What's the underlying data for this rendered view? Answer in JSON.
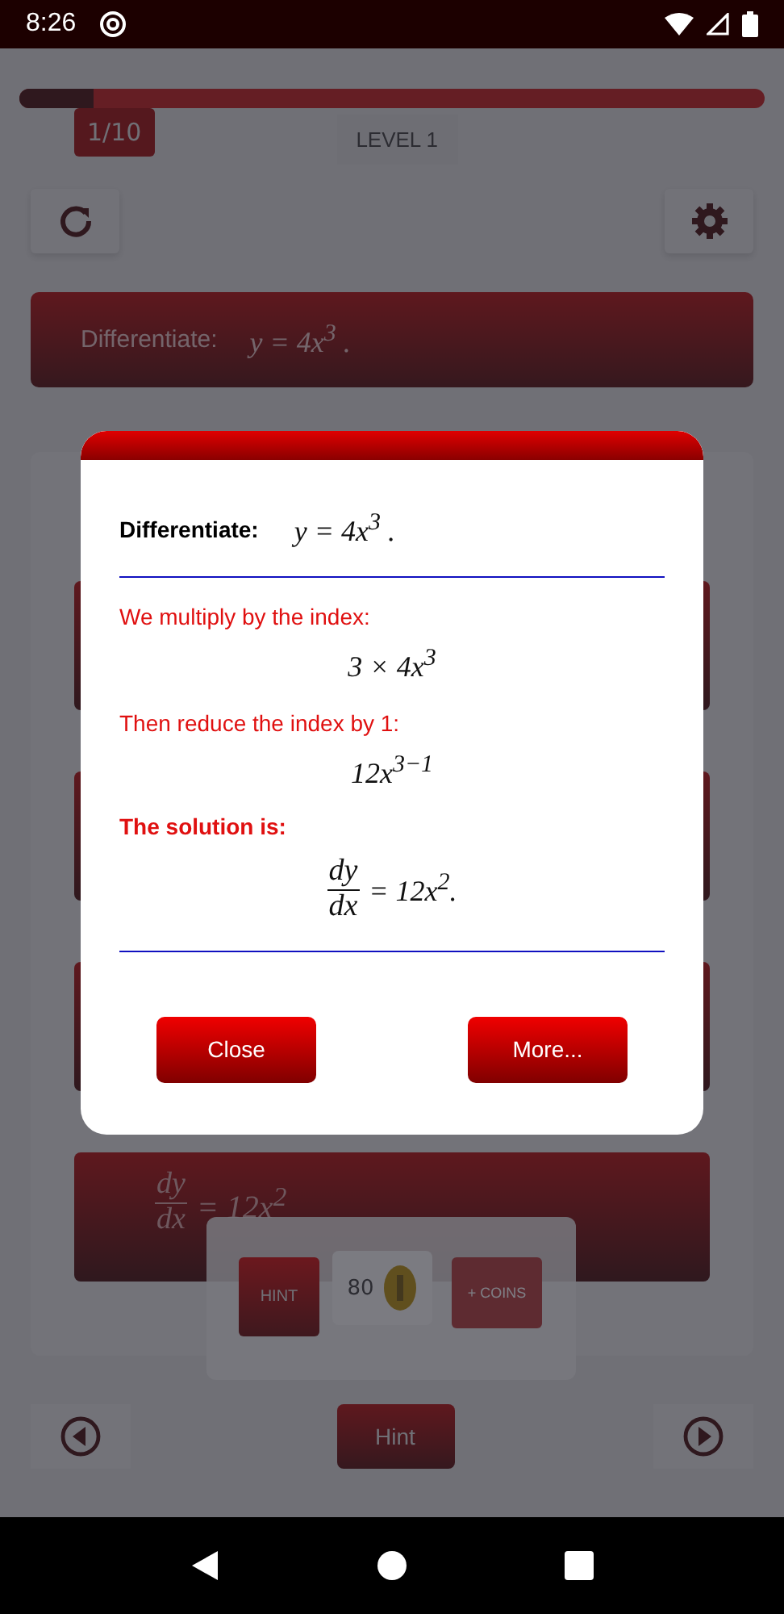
{
  "status_bar": {
    "time": "8:26"
  },
  "progress": {
    "level": 0.1,
    "counter": "1/10",
    "level_label": "LEVEL 1"
  },
  "question": {
    "label": "Differentiate:",
    "expression": "y = 4x$^{3}$ ."
  },
  "answers": [
    {
      "kind": "blank"
    },
    {
      "kind": "blank"
    },
    {
      "kind": "blank"
    },
    {
      "kind": "fraction",
      "numerator": "dy",
      "denominator": "dx",
      "rest": "= 12x$^{2}$"
    }
  ],
  "hint_popup": {
    "hint_button": "HINT",
    "coins": "80",
    "buy_button": "+ COINS"
  },
  "navigation": {
    "hint_button": "Hint"
  },
  "dialog": {
    "label": "Differentiate:",
    "expression": "y = 4x$^{3}$ .",
    "steps": [
      {
        "kind": "text",
        "text": "We multiply by the index:"
      },
      {
        "kind": "math",
        "text": "3 × 4x$^{3}$"
      },
      {
        "kind": "text",
        "text": "Then reduce the index by 1:"
      },
      {
        "kind": "math",
        "text": "12x$^{3−1}$"
      },
      {
        "kind": "heading",
        "text": "The solution is:"
      },
      {
        "kind": "fraction",
        "numerator": "dy",
        "denominator": "dx",
        "rest": "= 12x$^{2}$."
      }
    ],
    "buttons": [
      "Close",
      "More..."
    ]
  }
}
